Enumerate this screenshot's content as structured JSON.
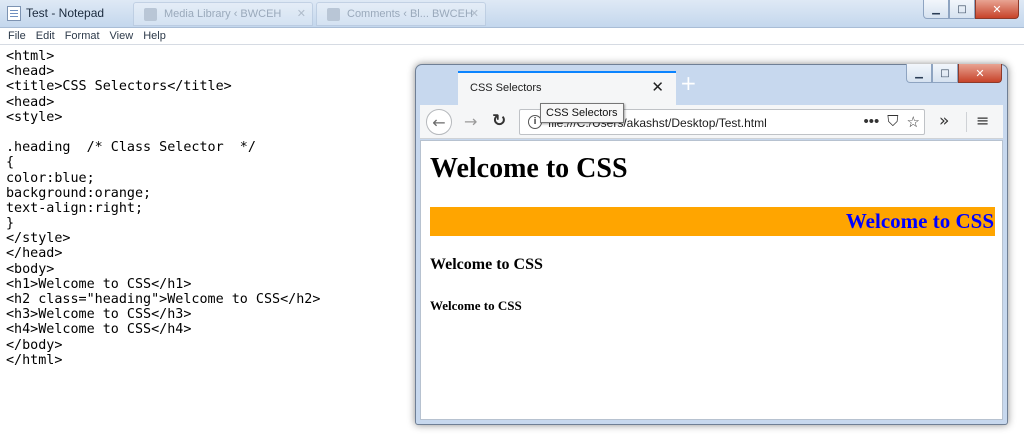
{
  "notepad": {
    "title": "Test - Notepad",
    "background_tabs": [
      {
        "label": "Media Library ‹ BWCEH"
      },
      {
        "label": "Comments ‹ Bl... BWCEH"
      }
    ],
    "menu": [
      "File",
      "Edit",
      "Format",
      "View",
      "Help"
    ],
    "lines": [
      "<html>",
      "<head>",
      "<title>CSS Selectors</title>",
      "<head>",
      "<style>",
      "",
      ".heading  /* Class Selector  */",
      "{",
      "color:blue;",
      "background:orange;",
      "text-align:right;",
      "}",
      "</style>",
      "</head>",
      "<body>",
      "<h1>Welcome to CSS</h1>",
      "<h2 class=\"heading\">Welcome to CSS</h2>",
      "<h3>Welcome to CSS</h3>",
      "<h4>Welcome to CSS</h4>",
      "</body>",
      "</html>"
    ]
  },
  "browser": {
    "tab_title": "CSS Selectors",
    "tooltip": "CSS Selectors",
    "url": "file:///C:/Users/akashst/Desktop/Test.html",
    "page": {
      "h1": "Welcome to CSS",
      "h2": "Welcome to CSS",
      "h3": "Welcome to CSS",
      "h4": "Welcome to CSS"
    },
    "colors": {
      "heading_text": "#0000ff",
      "heading_background": "#ffa500",
      "tab_accent": "#0a84ff"
    },
    "icons": {
      "back": "←",
      "forward": "→",
      "reload": "↻",
      "more": "•••",
      "pocket": "⛉",
      "bookmark": "☆",
      "overflow": "»",
      "menu": "≡",
      "close_tab": "✕",
      "new_tab": "+"
    }
  },
  "window_buttons": {
    "minimize": "▁",
    "maximize": "□",
    "close": "✕"
  }
}
